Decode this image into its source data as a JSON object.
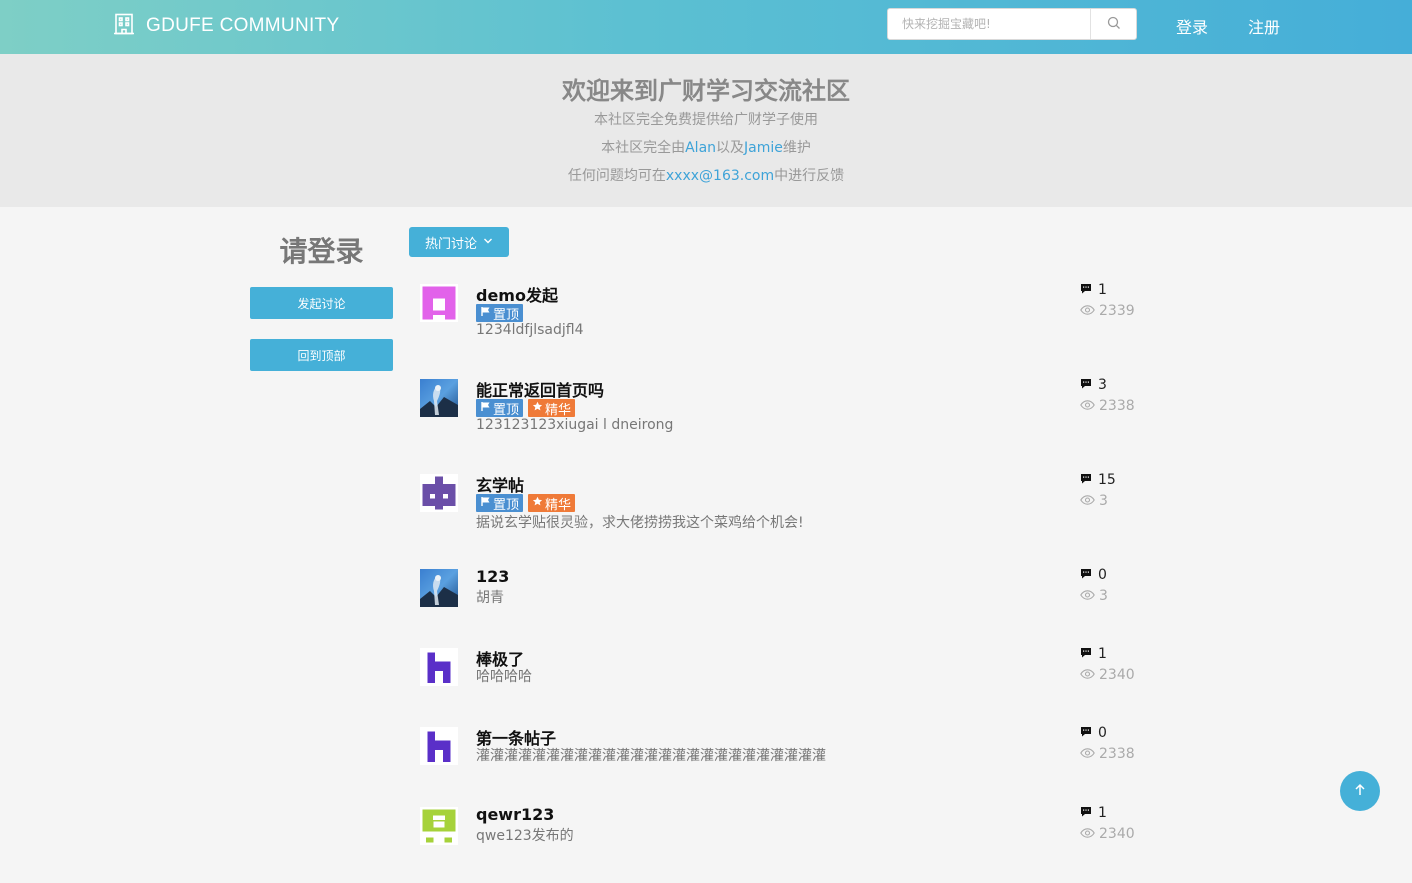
{
  "header": {
    "brand": "GDUFE COMMUNITY",
    "search_placeholder": "快来挖掘宝藏吧!",
    "login": "登录",
    "register": "注册"
  },
  "jumbotron": {
    "title": "欢迎来到广财学习交流社区",
    "line1": "本社区完全免费提供给广财学子使用",
    "line2_pre": "本社区完全由",
    "line2_a": "Alan",
    "line2_mid": "以及",
    "line2_b": "Jamie",
    "line2_post": "维护",
    "line3_pre": "任何问题均可在",
    "line3_email": "xxxx@163.com",
    "line3_post": "中进行反馈"
  },
  "sidebar": {
    "title": "请登录",
    "start_discussion": "发起讨论",
    "back_to_top": "回到顶部"
  },
  "filter": {
    "label": "热门讨论"
  },
  "posts": [
    {
      "title": "demo发起",
      "pinned": true,
      "featured": false,
      "excerpt": "1234ldfjlsadjfl4",
      "comments": "1",
      "views": "2339",
      "avatar": "pink-identicon"
    },
    {
      "title": "能正常返回首页吗",
      "pinned": true,
      "featured": true,
      "excerpt": "123123123xiugai l dneirong",
      "comments": "3",
      "views": "2338",
      "avatar": "photo-avatar"
    },
    {
      "title": "玄学帖",
      "pinned": true,
      "featured": true,
      "excerpt": "据说玄学贴很灵验，求大佬捞捞我这个菜鸡给个机会!",
      "comments": "15",
      "views": "3",
      "avatar": "purple-identicon"
    },
    {
      "title": "123",
      "pinned": false,
      "featured": false,
      "excerpt": "胡青",
      "comments": "0",
      "views": "3",
      "avatar": "photo-avatar"
    },
    {
      "title": "棒极了",
      "pinned": false,
      "featured": false,
      "excerpt": "哈哈哈哈",
      "comments": "1",
      "views": "2340",
      "avatar": "violet-identicon"
    },
    {
      "title": "第一条帖子",
      "pinned": false,
      "featured": false,
      "excerpt": "灌灌灌灌灌灌灌灌灌灌灌灌灌灌灌灌灌灌灌灌灌灌灌灌灌",
      "comments": "0",
      "views": "2338",
      "avatar": "violet-identicon"
    },
    {
      "title": "qewr123",
      "pinned": false,
      "featured": false,
      "excerpt": "qwe123发布的",
      "comments": "1",
      "views": "2340",
      "avatar": "lime-identicon"
    }
  ],
  "badges": {
    "pinned": "置顶",
    "featured": "精华"
  },
  "colors": {
    "accent": "#45b0d8",
    "pinned": "#4a8fd1",
    "featured": "#ef7a38"
  }
}
